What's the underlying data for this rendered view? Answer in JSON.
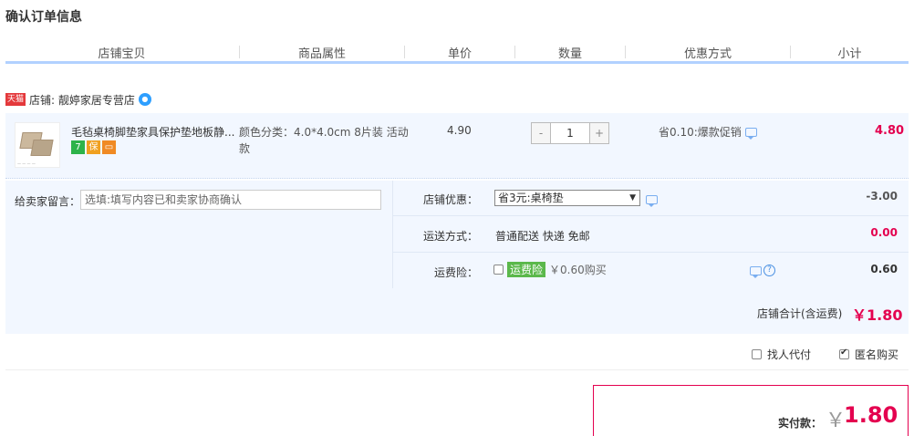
{
  "page": {
    "title": "确认订单信息"
  },
  "columns": [
    "店铺宝贝",
    "商品属性",
    "单价",
    "数量",
    "优惠方式",
    "小计"
  ],
  "shop": {
    "badge": "天猫",
    "label": "店铺: 靓婷家居专营店"
  },
  "item": {
    "name": "毛毡桌椅脚垫家具保护垫地板静...",
    "attribute": "颜色分类：4.0*4.0cm 8片装 活动款",
    "price": "4.90",
    "qty_minus": "-",
    "qty": "1",
    "qty_plus": "+",
    "promo": "省0.10:爆款促销",
    "subtotal": "4.80",
    "badges": [
      {
        "text": "7",
        "color": "#2db34a"
      },
      {
        "text": "保",
        "color": "#f0a020"
      },
      {
        "text": "▭",
        "color": "#f08a24"
      }
    ]
  },
  "message": {
    "label": "给卖家留言：",
    "placeholder": "选填:填写内容已和卖家协商确认"
  },
  "shop_discount": {
    "label": "店铺优惠：",
    "selected": "省3元:桌椅垫",
    "amount": "-3.00"
  },
  "shipping": {
    "label": "运送方式：",
    "value": "普通配送 快递 免邮",
    "amount": "0.00"
  },
  "insurance": {
    "label": "运费险：",
    "badge": "运费险",
    "value": "￥0.60购买",
    "amount": "0.60"
  },
  "shop_total": {
    "label": "店铺合计(含运费)",
    "value": "￥1.80"
  },
  "extras": {
    "proxy": "找人代付",
    "anonymous": "匿名购买"
  },
  "pay": {
    "label": "实付款：",
    "yen": "￥",
    "value": "1.80"
  }
}
